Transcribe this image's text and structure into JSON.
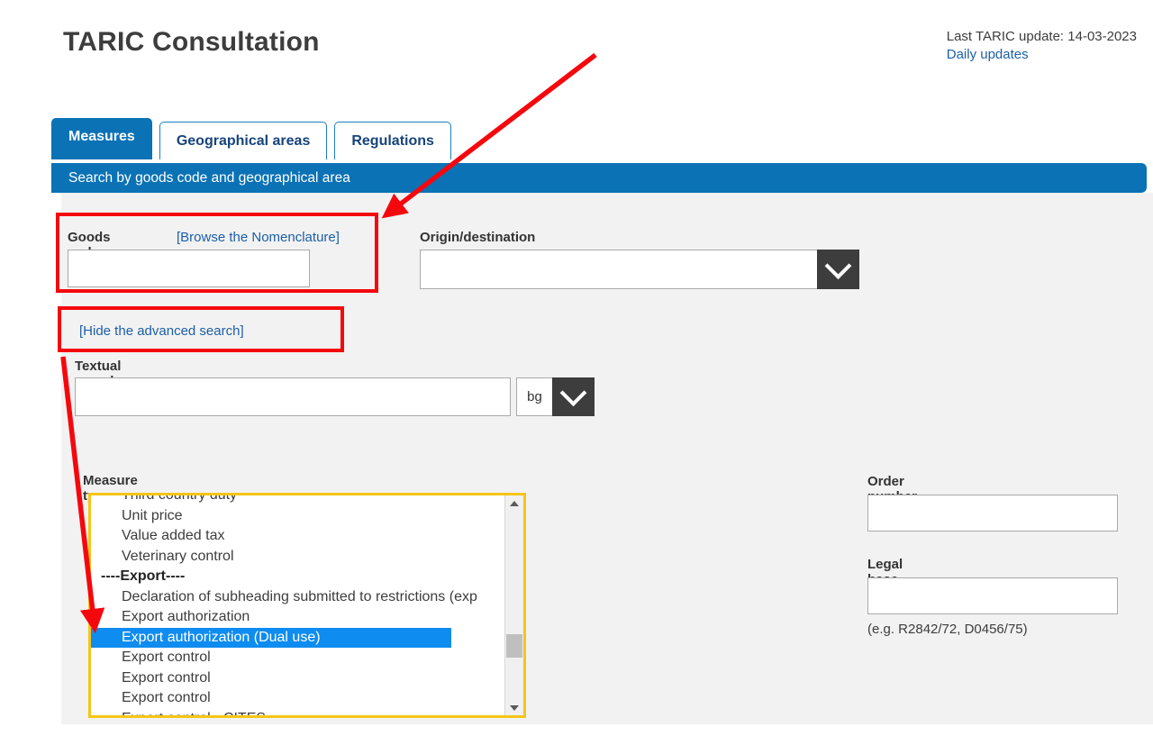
{
  "header": {
    "title": "TARIC Consultation",
    "last_update_label": "Last TARIC update:",
    "last_update_date": "14-03-2023",
    "daily_updates_link": "Daily updates"
  },
  "tabs": [
    {
      "label": "Measures",
      "active": true
    },
    {
      "label": "Geographical areas",
      "active": false
    },
    {
      "label": "Regulations",
      "active": false
    }
  ],
  "search_bar": {
    "title": "Search by goods code and geographical area"
  },
  "form": {
    "goods_code": {
      "label": "Goods code",
      "browse_link": "[Browse the Nomenclature]",
      "value": "",
      "placeholder": ""
    },
    "origin_destination": {
      "label": "Origin/destination",
      "value": "",
      "placeholder": "",
      "dropdown_icon": "chevron-down-icon"
    },
    "hide_advanced_link": "[Hide the advanced search]",
    "textual_search": {
      "label": "Textual search",
      "value": "",
      "placeholder": "",
      "language_value": "bg",
      "dropdown_icon": "chevron-down-icon"
    },
    "measure_type": {
      "label": "Measure type",
      "selected": "Export authorization (Dual use)",
      "options": [
        {
          "label": "Third country duty",
          "group": false,
          "clipped_top": true
        },
        {
          "label": "Unit price",
          "group": false
        },
        {
          "label": "Value added tax",
          "group": false
        },
        {
          "label": "Veterinary control",
          "group": false
        },
        {
          "label": "----Export----",
          "group": true
        },
        {
          "label": "Declaration of subheading submitted to restrictions (exp",
          "group": false
        },
        {
          "label": "Export authorization",
          "group": false
        },
        {
          "label": "Export authorization (Dual use)",
          "group": false,
          "selected": true
        },
        {
          "label": "Export control",
          "group": false
        },
        {
          "label": "Export control",
          "group": false
        },
        {
          "label": "Export control",
          "group": false
        },
        {
          "label": "Export control - CITES",
          "group": false,
          "clipped_bottom": true
        }
      ],
      "scrollbar": {
        "up_icon": "triangle-up-icon",
        "down_icon": "triangle-down-icon"
      },
      "highlight_color": "#f5c518",
      "selection_color": "#0f8cf0"
    },
    "order_number": {
      "label": "Order number",
      "value": "",
      "placeholder": ""
    },
    "legal_base": {
      "label": "Legal base",
      "value": "",
      "placeholder": "",
      "hint": "(e.g. R2842/72, D0456/75)"
    }
  },
  "annotations": {
    "box_color": "#f5080d",
    "arrow_color": "#f5080d",
    "boxes": [
      {
        "name": "goods-code-highlight"
      },
      {
        "name": "hide-advanced-highlight"
      }
    ],
    "arrows": [
      {
        "name": "arrow-to-goods-code"
      },
      {
        "name": "arrow-to-measure-type"
      }
    ]
  },
  "colors": {
    "brand_blue": "#0b72b5",
    "link_blue": "#1c5fa8",
    "panel_gray": "#f2f2f2",
    "dark_button": "#3d3d3d"
  }
}
